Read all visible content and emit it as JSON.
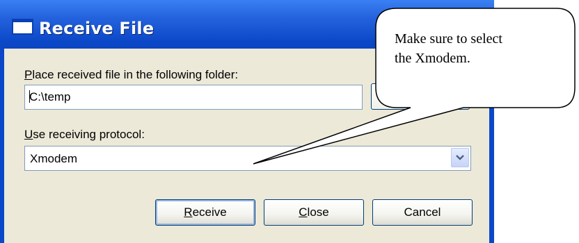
{
  "window": {
    "title": "Receive File"
  },
  "folder": {
    "label_accel": "P",
    "label_rest": "lace received file in the following folder:",
    "value": "C:\\temp"
  },
  "protocol": {
    "label_accel": "U",
    "label_rest": "se receiving protocol:",
    "selected": "Xmodem"
  },
  "buttons": {
    "receive_accel": "R",
    "receive_rest": "eceive",
    "close_accel": "C",
    "close_rest": "lose",
    "cancel": "Cancel"
  },
  "callout": {
    "text_line1": "Make sure to select",
    "text_line2": "the Xmodem."
  },
  "icons": {
    "window_icon": "window-icon",
    "dropdown_arrow": "chevron-down-icon"
  },
  "colors": {
    "titlebar": "#0b48c8",
    "dialog_bg": "#ece9d8",
    "field_border": "#7f9db9"
  }
}
